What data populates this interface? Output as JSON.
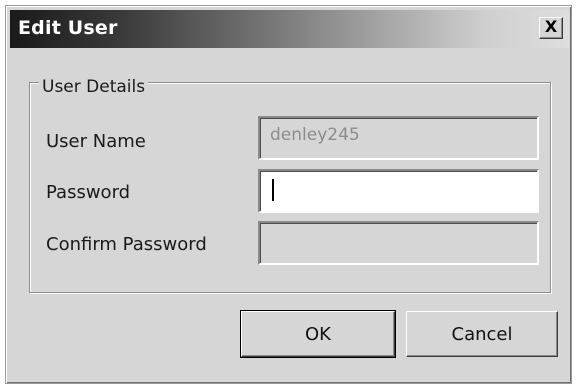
{
  "window": {
    "title": "Edit User",
    "close_glyph": "X"
  },
  "group": {
    "legend": "User Details"
  },
  "fields": {
    "username": {
      "label": "User Name",
      "value": "denley245",
      "enabled": false
    },
    "password": {
      "label": "Password",
      "value": "",
      "enabled": true,
      "focused": true
    },
    "confirm_password": {
      "label": "Confirm Password",
      "value": "",
      "enabled": false
    }
  },
  "buttons": {
    "ok": "OK",
    "cancel": "Cancel"
  },
  "icons": {
    "close": "close-icon"
  }
}
